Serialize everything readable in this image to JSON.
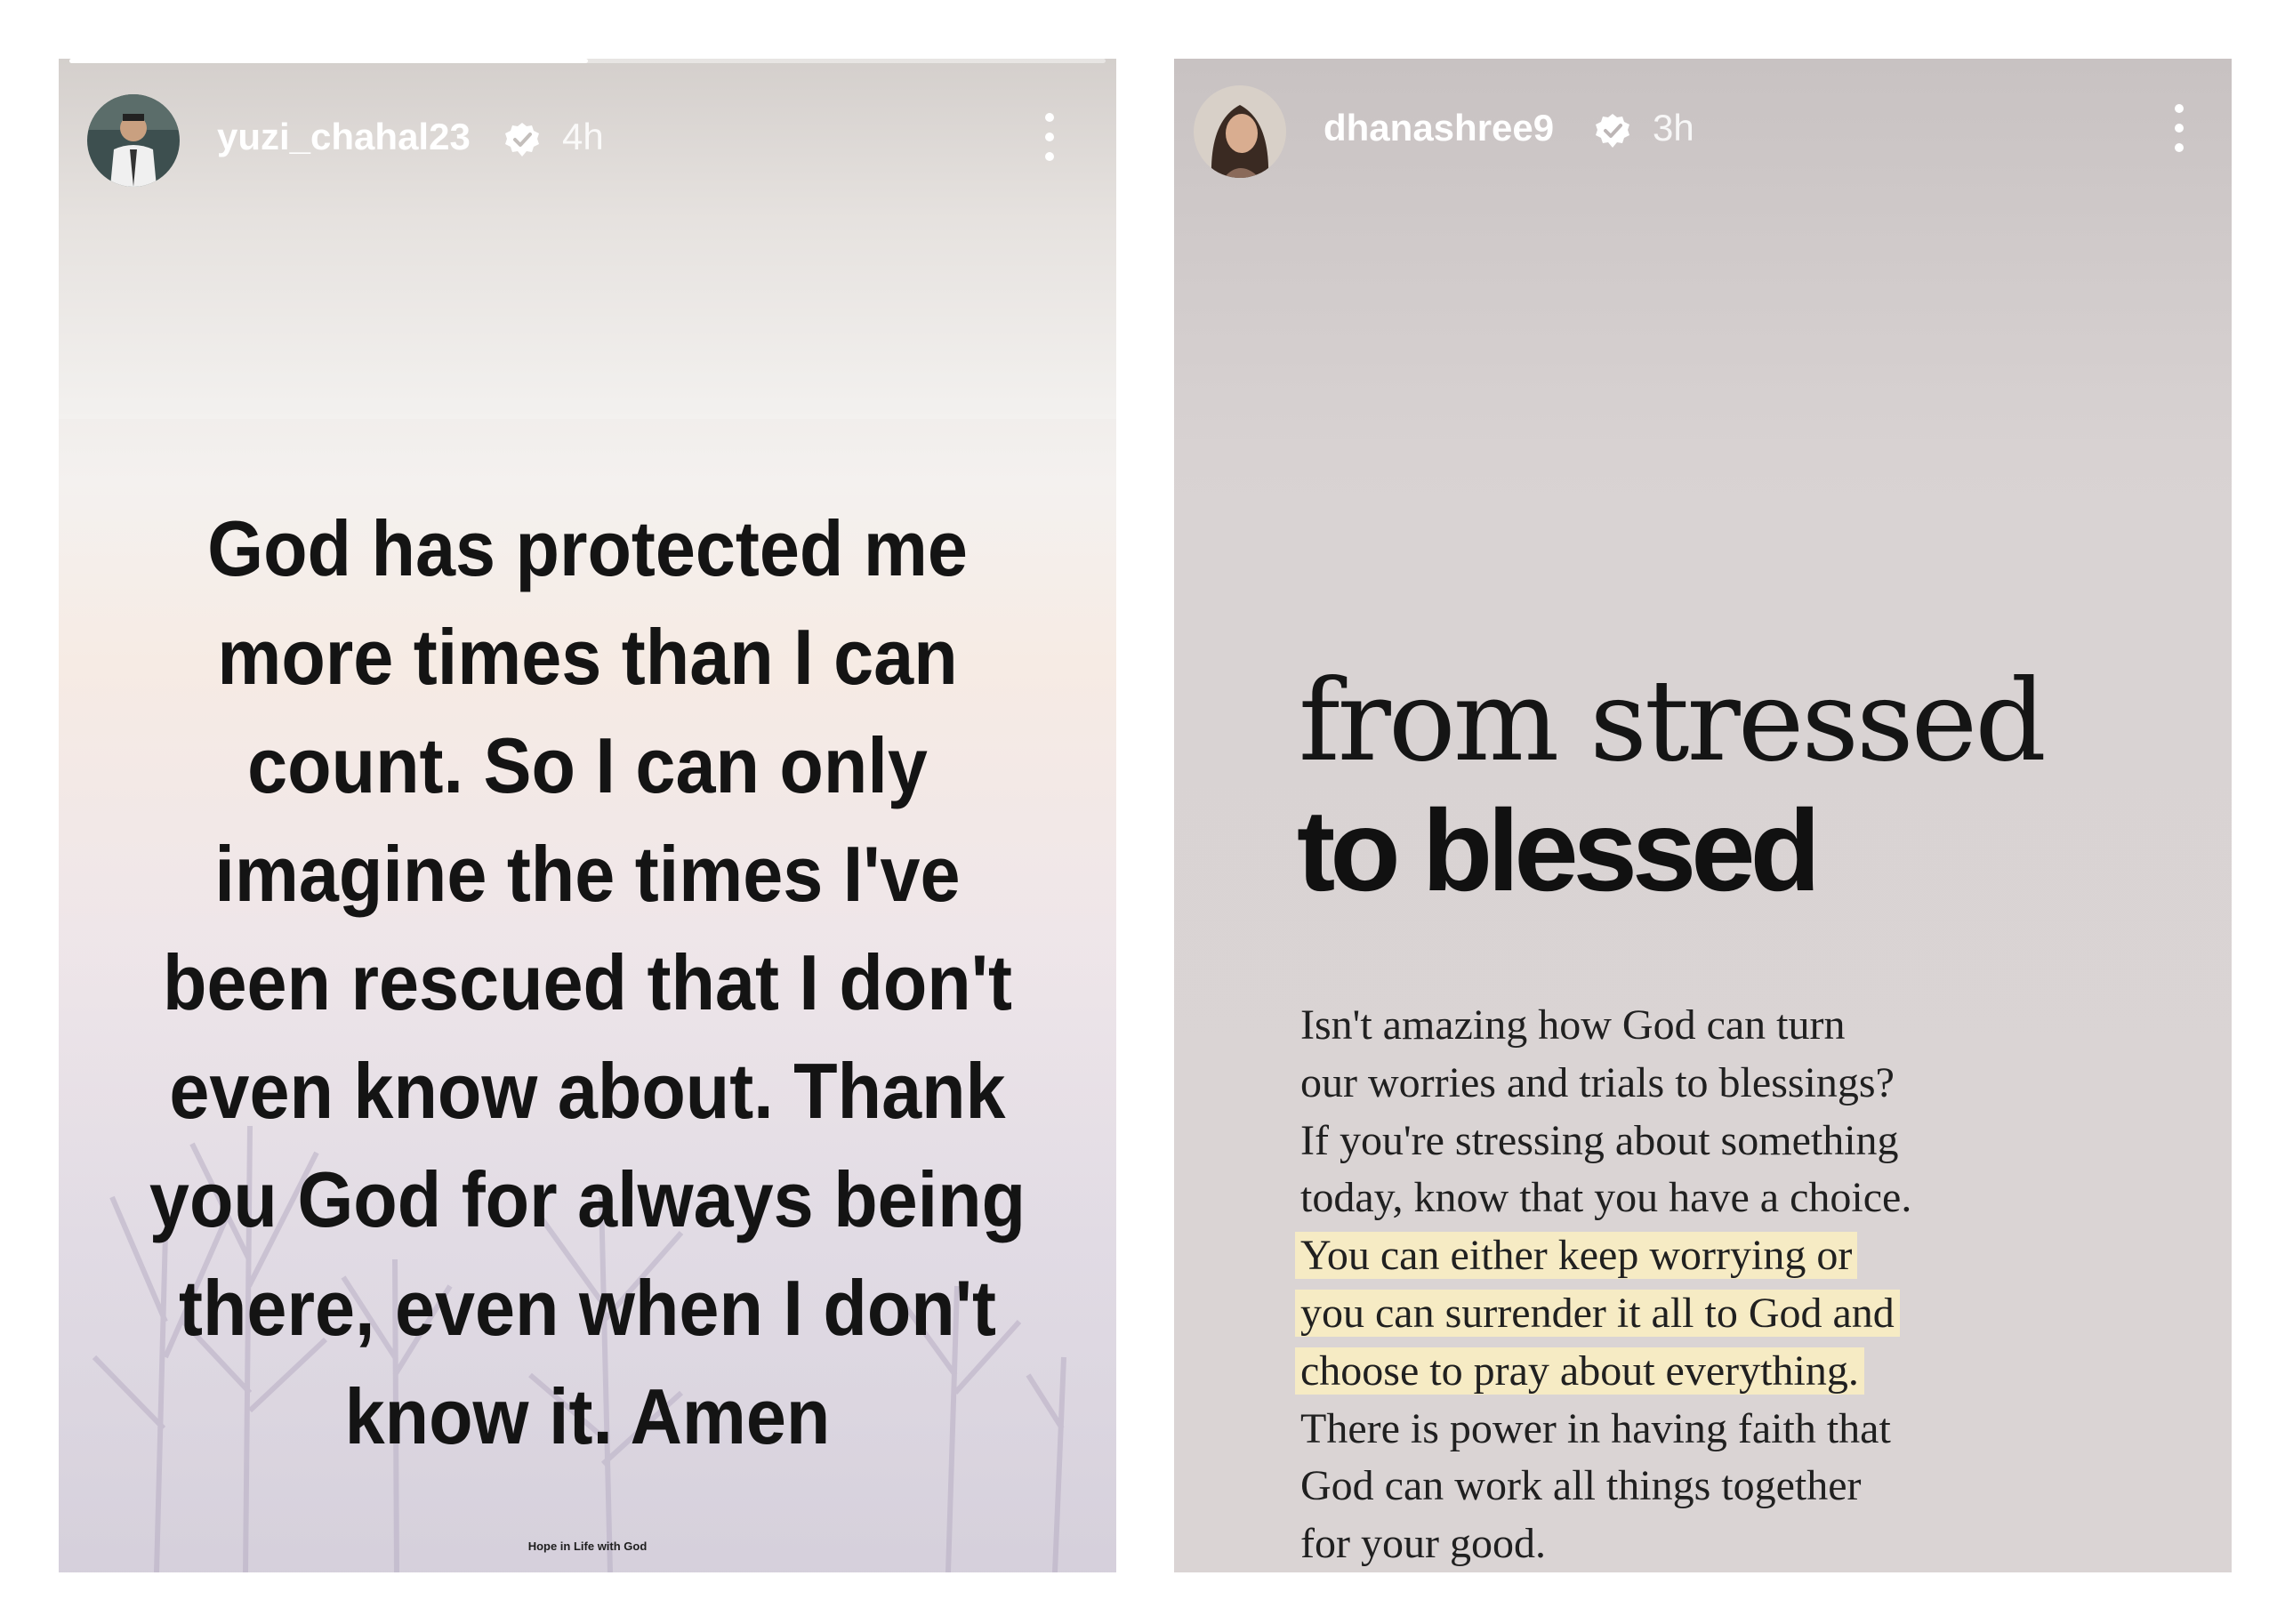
{
  "left_story": {
    "progress": 0.5,
    "username": "yuzi_chahal23",
    "time": "4h",
    "quote_lines": [
      "God has protected me",
      "more times than I can",
      "count. So I can only",
      "imagine the times I've",
      "been rescued that I don't",
      "even know about. Thank",
      "you God for always being",
      "there, even when I don't",
      "know it. Amen"
    ],
    "watermark": "Hope in Life with God"
  },
  "right_story": {
    "username": "dhanashree9",
    "time": "3h",
    "title_line1": "from stressed",
    "title_line2": "to blessed",
    "body_lines": [
      {
        "text": "Isn't amazing how God can turn",
        "highlighted": false
      },
      {
        "text": "our worries and trials to blessings?",
        "highlighted": false
      },
      {
        "text": "If you're stressing about something",
        "highlighted": false
      },
      {
        "text": "today, know that you have a choice.",
        "highlighted": false
      },
      {
        "text": "You can either keep worrying or",
        "highlighted": true
      },
      {
        "text": "you can surrender it all to God and",
        "highlighted": true
      },
      {
        "text": "choose to pray about everything.",
        "highlighted": true
      },
      {
        "text": "There is power in having faith that",
        "highlighted": false
      },
      {
        "text": "God can work all things together",
        "highlighted": false
      },
      {
        "text": "for your good.",
        "highlighted": false
      }
    ]
  },
  "icons": {
    "verified": "verified-badge-icon",
    "more": "more-options-icon"
  },
  "colors": {
    "highlight": "#f6ebc4",
    "quote_text": "#141414"
  }
}
